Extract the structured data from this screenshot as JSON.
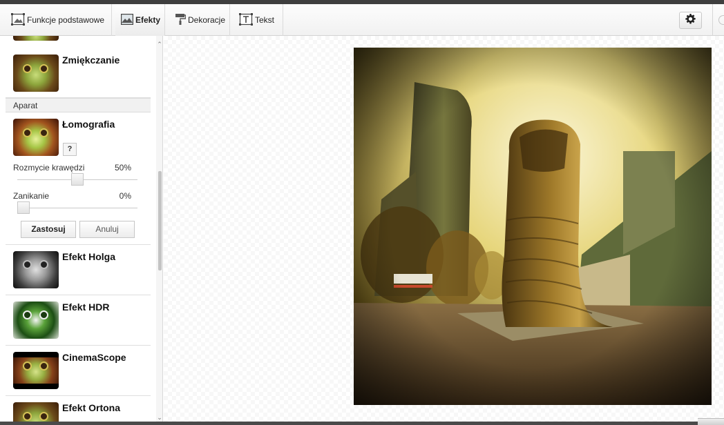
{
  "toolbar": {
    "tabs": [
      {
        "label": "Funkcje podstawowe",
        "icon": "image-icon"
      },
      {
        "label": "Efekty",
        "icon": "landscape-icon",
        "active": true
      },
      {
        "label": "Dekoracje",
        "icon": "paint-roller-icon"
      },
      {
        "label": "Tekst",
        "icon": "text-box-icon"
      }
    ],
    "settings_icon": "gear-icon"
  },
  "sidebar": {
    "effects_top": [
      {
        "title": "Zmiękczanie",
        "thumb": "frog-warm"
      }
    ],
    "section": "Aparat",
    "lomo": {
      "title": "Łomografia",
      "help_label": "?",
      "params": [
        {
          "label": "Rozmycie krawędzi",
          "value": "50%",
          "level": 0.5
        },
        {
          "label": "Zanikanie",
          "value": "0%",
          "level": 0.0
        }
      ],
      "apply_label": "Zastosuj",
      "cancel_label": "Anuluj"
    },
    "effects_bottom": [
      {
        "title": "Efekt Holga",
        "thumb": "frog-bw"
      },
      {
        "title": "Efekt HDR",
        "thumb": "frog-hdr"
      },
      {
        "title": "CinemaScope",
        "thumb": "frog-cinema"
      },
      {
        "title": "Efekt Ortona",
        "thumb": "frog-warm"
      }
    ]
  },
  "colors": {
    "toolbar_bg": "#f4f4f4",
    "text": "#222222",
    "photo_tone": "#c9a83a"
  }
}
